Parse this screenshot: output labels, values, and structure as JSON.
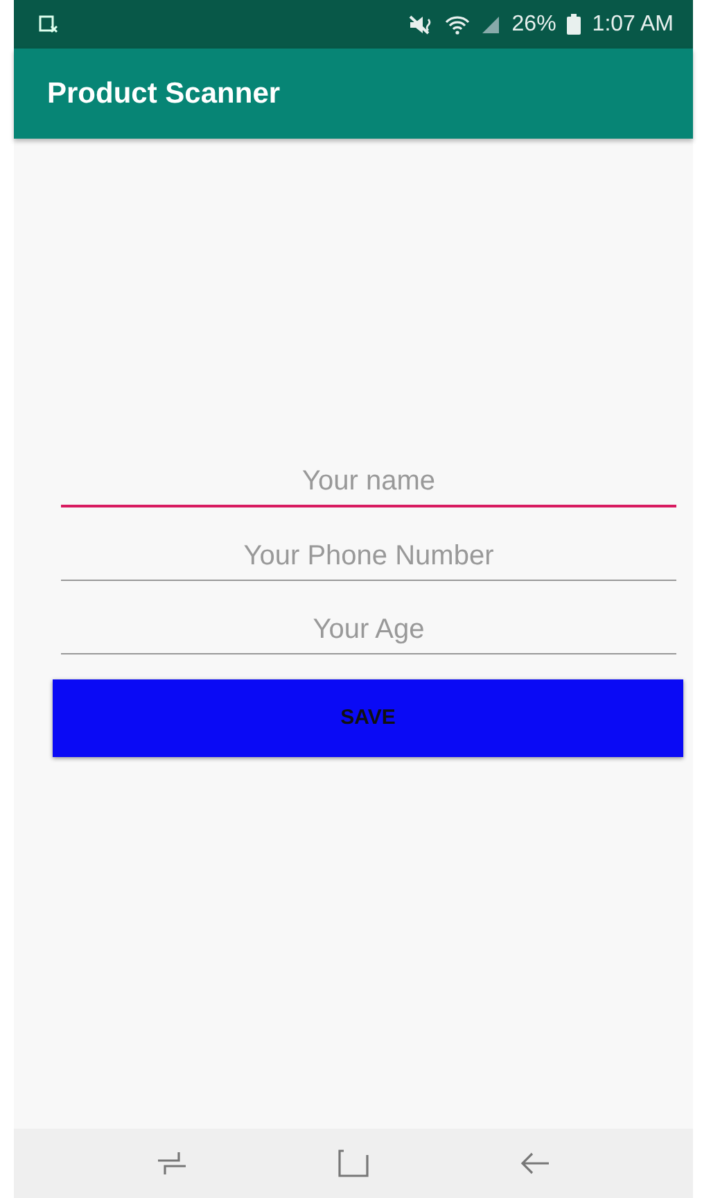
{
  "status_bar": {
    "battery": "26%",
    "time": "1:07 AM"
  },
  "app_bar": {
    "title": "Product Scanner"
  },
  "fields": [
    {
      "placeholder": "Your name",
      "focused": true
    },
    {
      "placeholder": "Your Phone Number",
      "focused": false
    },
    {
      "placeholder": "Your Age",
      "focused": false
    }
  ],
  "button": {
    "label": "SAVE"
  }
}
